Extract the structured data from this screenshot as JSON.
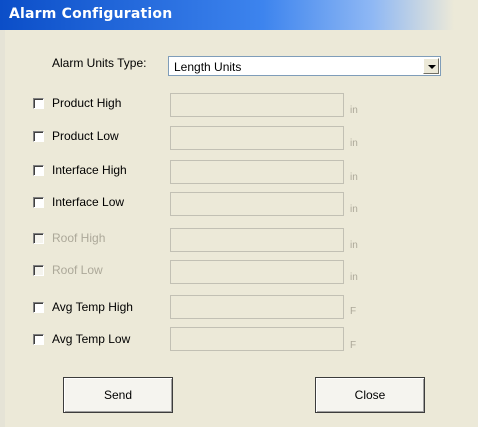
{
  "window": {
    "title": "Alarm Configuration"
  },
  "alarm_units": {
    "label": "Alarm Units Type:",
    "selected": "Length Units"
  },
  "alarms": [
    {
      "label": "Product High",
      "unit": "in",
      "enabled": true
    },
    {
      "label": "Product Low",
      "unit": "in",
      "enabled": true
    },
    {
      "label": "Interface High",
      "unit": "in",
      "enabled": true
    },
    {
      "label": "Interface Low",
      "unit": "in",
      "enabled": true
    },
    {
      "label": "Roof High",
      "unit": "in",
      "enabled": false
    },
    {
      "label": "Roof Low",
      "unit": "in",
      "enabled": false
    },
    {
      "label": "Avg Temp High",
      "unit": "F",
      "enabled": true
    },
    {
      "label": "Avg Temp Low",
      "unit": "F",
      "enabled": true
    }
  ],
  "buttons": {
    "send": "Send",
    "close": "Close"
  }
}
